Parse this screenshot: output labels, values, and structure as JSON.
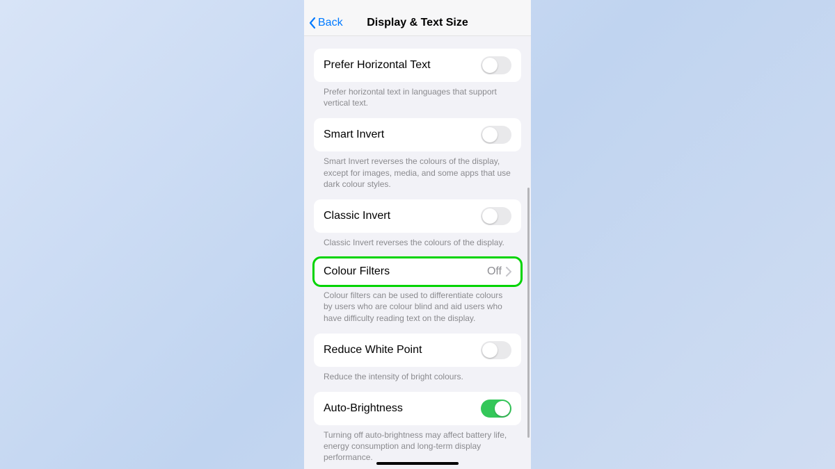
{
  "nav": {
    "back_label": "Back",
    "title": "Display & Text Size"
  },
  "rows": {
    "prefer_horizontal": {
      "label": "Prefer Horizontal Text",
      "desc": "Prefer horizontal text in languages that support vertical text.",
      "on": false
    },
    "smart_invert": {
      "label": "Smart Invert",
      "desc": "Smart Invert reverses the colours of the display, except for images, media, and some apps that use dark colour styles.",
      "on": false
    },
    "classic_invert": {
      "label": "Classic Invert",
      "desc": "Classic Invert reverses the colours of the display.",
      "on": false
    },
    "colour_filters": {
      "label": "Colour Filters",
      "value": "Off",
      "desc": "Colour filters can be used to differentiate colours by users who are colour blind and aid users who have difficulty reading text on the display."
    },
    "reduce_white_point": {
      "label": "Reduce White Point",
      "desc": "Reduce the intensity of bright colours.",
      "on": false
    },
    "auto_brightness": {
      "label": "Auto-Brightness",
      "desc": "Turning off auto-brightness may affect battery life, energy consumption and long-term display performance.",
      "on": true
    }
  }
}
